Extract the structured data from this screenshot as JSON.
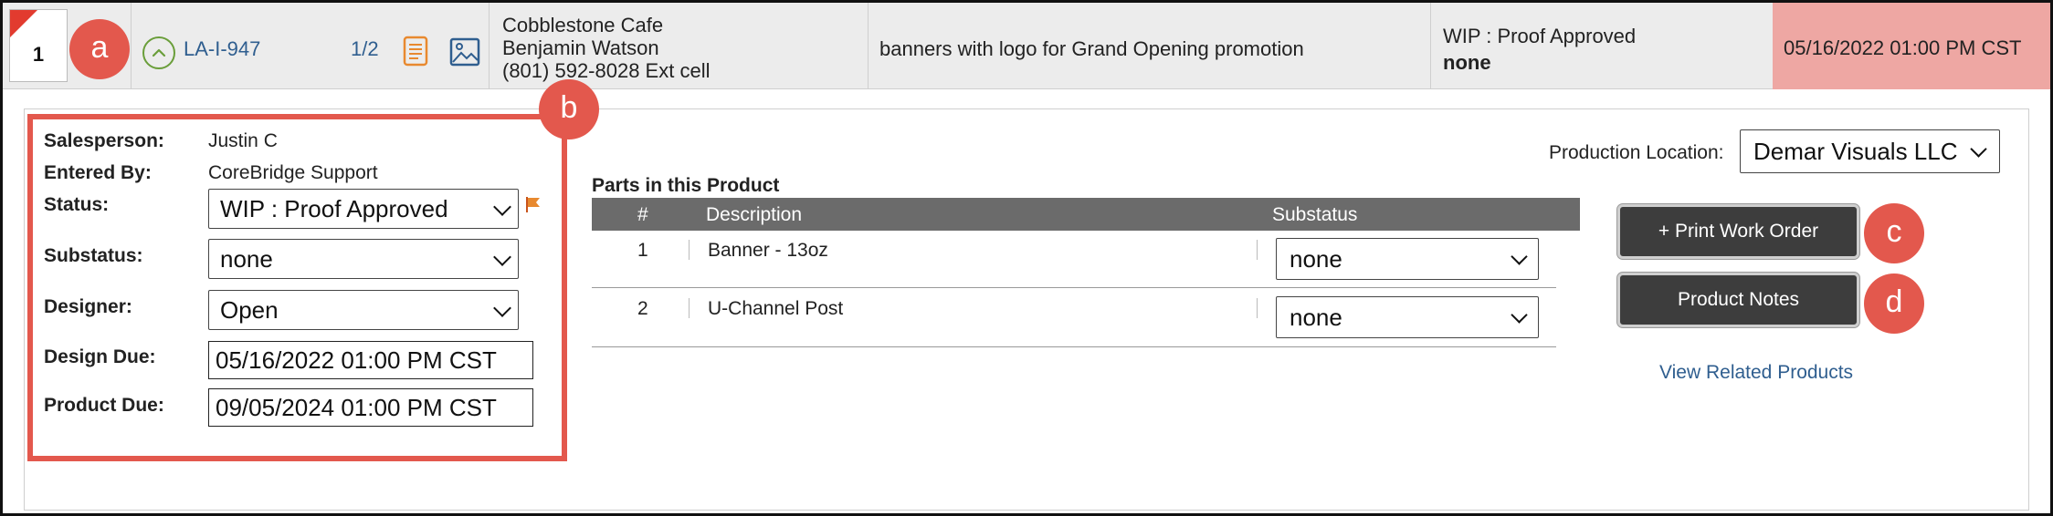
{
  "header": {
    "row_number": "1",
    "order_id": "LA-I-947",
    "part_fraction": "1/2",
    "customer": {
      "company": "Cobblestone Cafe",
      "contact": "Benjamin Watson",
      "phone": "(801) 592-8028 Ext cell"
    },
    "description": "banners with logo for Grand Opening promotion",
    "status": "WIP : Proof Approved",
    "substatus": "none",
    "due": "05/16/2022 01:00 PM CST",
    "icons": [
      "flag-corner-icon",
      "chevron-up-circle-icon",
      "document-icon",
      "image-icon"
    ],
    "colors": {
      "link": "#2f5e8f",
      "due_bg": "#eea7a3",
      "callout": "#e3584d",
      "status_ok": "#6a9e3a",
      "flag": "#e23b2f"
    }
  },
  "details": {
    "salesperson_label": "Salesperson:",
    "salesperson": "Justin C",
    "entered_by_label": "Entered By:",
    "entered_by": "CoreBridge Support",
    "status_label": "Status:",
    "status_value": "WIP : Proof Approved",
    "substatus_label": "Substatus:",
    "substatus_value": "none",
    "designer_label": "Designer:",
    "designer_value": "Open",
    "design_due_label": "Design Due:",
    "design_due_value": "05/16/2022 01:00 PM CST",
    "product_due_label": "Product Due:",
    "product_due_value": "09/05/2024 01:00 PM CST"
  },
  "parts": {
    "title": "Parts in this Product",
    "columns": [
      "#",
      "Description",
      "Substatus"
    ],
    "rows": [
      {
        "num": "1",
        "description": "Banner - 13oz",
        "substatus": "none"
      },
      {
        "num": "2",
        "description": "U-Channel Post",
        "substatus": "none"
      }
    ]
  },
  "right": {
    "production_location_label": "Production Location:",
    "production_location_value": "Demar Visuals LLC",
    "print_work_order_label": "+ Print Work Order",
    "product_notes_label": "Product Notes",
    "view_related_label": "View Related Products"
  },
  "callouts": {
    "a": "a",
    "b": "b",
    "c": "c",
    "d": "d"
  }
}
